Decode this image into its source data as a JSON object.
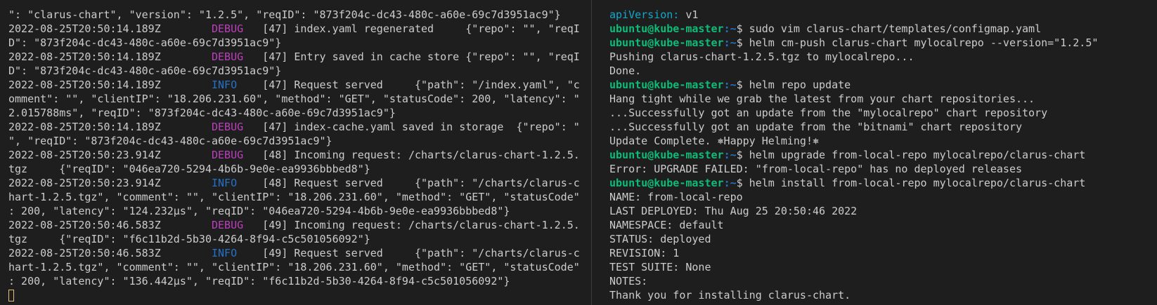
{
  "colors": {
    "background": "#1e1e1e",
    "text": "#cccccc",
    "debug": "#bc3fbc",
    "info": "#2472c8",
    "prompt_user": "#0dbc79",
    "prompt_path": "#2472c8",
    "cursor": "#e5c07b"
  },
  "left": {
    "l0": "\": \"clarus-chart\", \"version\": \"1.2.5\", \"reqID\": \"873f204c-dc43-480c-a60e-69c7d3951ac9\"}",
    "l1": {
      "ts": "2022-08-25T20:50:14.189Z",
      "level": "DEBUG",
      "msg": "[47] index.yaml regenerated     {\"repo\": \"\", \"reqI"
    },
    "l2": "D\": \"873f204c-dc43-480c-a60e-69c7d3951ac9\"}",
    "l3": {
      "ts": "2022-08-25T20:50:14.189Z",
      "level": "DEBUG",
      "msg": "[47] Entry saved in cache store {\"repo\": \"\", \"reqI"
    },
    "l4": "D\": \"873f204c-dc43-480c-a60e-69c7d3951ac9\"}",
    "l5": {
      "ts": "2022-08-25T20:50:14.189Z",
      "level": "INFO",
      "msg": "[47] Request served     {\"path\": \"/index.yaml\", \"c"
    },
    "l6": "omment\": \"\", \"clientIP\": \"18.206.231.60\", \"method\": \"GET\", \"statusCode\": 200, \"latency\": \"",
    "l7": "2.015788ms\", \"reqID\": \"873f204c-dc43-480c-a60e-69c7d3951ac9\"}",
    "l8": {
      "ts": "2022-08-25T20:50:14.189Z",
      "level": "DEBUG",
      "msg": "[47] index-cache.yaml saved in storage  {\"repo\": \""
    },
    "l9": "\", \"reqID\": \"873f204c-dc43-480c-a60e-69c7d3951ac9\"}",
    "l10": {
      "ts": "2022-08-25T20:50:23.914Z",
      "level": "DEBUG",
      "msg": "[48] Incoming request: /charts/clarus-chart-1.2.5."
    },
    "l11": "tgz     {\"reqID\": \"046ea720-5294-4b6b-9e0e-ea9936bbbed8\"}",
    "l12": {
      "ts": "2022-08-25T20:50:23.914Z",
      "level": "INFO",
      "msg": "[48] Request served     {\"path\": \"/charts/clarus-c"
    },
    "l13": "hart-1.2.5.tgz\", \"comment\": \"\", \"clientIP\": \"18.206.231.60\", \"method\": \"GET\", \"statusCode\"",
    "l14": ": 200, \"latency\": \"124.232µs\", \"reqID\": \"046ea720-5294-4b6b-9e0e-ea9936bbbed8\"}",
    "l15": {
      "ts": "2022-08-25T20:50:46.583Z",
      "level": "DEBUG",
      "msg": "[49] Incoming request: /charts/clarus-chart-1.2.5."
    },
    "l16": "tgz     {\"reqID\": \"f6c11b2d-5b30-4264-8f94-c5c501056092\"}",
    "l17": {
      "ts": "2022-08-25T20:50:46.583Z",
      "level": "INFO",
      "msg": "[49] Request served     {\"path\": \"/charts/clarus-c"
    },
    "l18": "hart-1.2.5.tgz\", \"comment\": \"\", \"clientIP\": \"18.206.231.60\", \"method\": \"GET\", \"statusCode\"",
    "l19": ": 200, \"latency\": \"136.442µs\", \"reqID\": \"f6c11b2d-5b30-4264-8f94-c5c501056092\"}"
  },
  "right": {
    "r0": {
      "key": "apiVersion:",
      "value": " v1"
    },
    "r1": {
      "user": "ubuntu@kube-master",
      "path": ":~",
      "cmd": "$ sudo vim clarus-chart/templates/configmap.yaml"
    },
    "r2": {
      "user": "ubuntu@kube-master",
      "path": ":~",
      "cmd": "$ helm cm-push clarus-chart mylocalrepo --version=\"1.2.5\""
    },
    "r3": "Pushing clarus-chart-1.2.5.tgz to mylocalrepo...",
    "r4": "Done.",
    "r5": {
      "user": "ubuntu@kube-master",
      "path": ":~",
      "cmd": "$ helm repo update"
    },
    "r6": "Hang tight while we grab the latest from your chart repositories...",
    "r7": "...Successfully got an update from the \"mylocalrepo\" chart repository",
    "r8": "...Successfully got an update from the \"bitnami\" chart repository",
    "r9": "Update Complete. ⎈Happy Helming!⎈",
    "r10": {
      "user": "ubuntu@kube-master",
      "path": ":~",
      "cmd": "$ helm upgrade from-local-repo mylocalrepo/clarus-chart"
    },
    "r11": "Error: UPGRADE FAILED: \"from-local-repo\" has no deployed releases",
    "r12": {
      "user": "ubuntu@kube-master",
      "path": ":~",
      "cmd": "$ helm install from-local-repo mylocalrepo/clarus-chart"
    },
    "r13": "NAME: from-local-repo",
    "r14": "LAST DEPLOYED: Thu Aug 25 20:50:46 2022",
    "r15": "NAMESPACE: default",
    "r16": "STATUS: deployed",
    "r17": "REVISION: 1",
    "r18": "TEST SUITE: None",
    "r19": "NOTES:",
    "r20": "Thank you for installing clarus-chart."
  }
}
